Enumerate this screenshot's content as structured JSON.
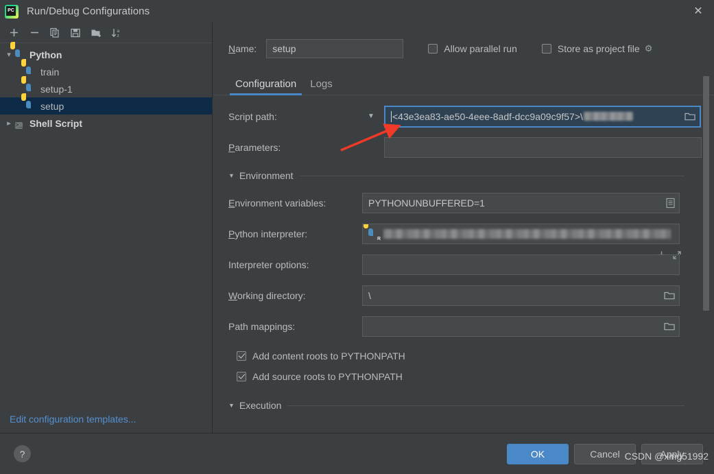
{
  "window": {
    "title": "Run/Debug Configurations",
    "logo_icon": "pycharm-logo",
    "close_icon": "close-icon"
  },
  "toolbar": {
    "buttons": [
      {
        "name": "add",
        "icon": "plus-icon",
        "label": "+"
      },
      {
        "name": "remove",
        "icon": "minus-icon",
        "label": "−"
      },
      {
        "name": "copy",
        "icon": "copy-icon",
        "label": "copy"
      },
      {
        "name": "save",
        "icon": "save-icon",
        "label": "save"
      },
      {
        "name": "new-folder",
        "icon": "folder-add-icon",
        "label": "new folder"
      },
      {
        "name": "sort-alphabetically",
        "icon": "sort-az-icon",
        "label": "sort a-z"
      }
    ]
  },
  "sidebar": {
    "tree": [
      {
        "label": "Python",
        "icon": "python-icon",
        "expanded": true,
        "level": 0,
        "selected": false,
        "chevron": "∨"
      },
      {
        "label": "train",
        "icon": "python-icon",
        "level": 1,
        "selected": false,
        "chevron": ""
      },
      {
        "label": "setup-1",
        "icon": "python-icon",
        "level": 1,
        "selected": false,
        "chevron": ""
      },
      {
        "label": "setup",
        "icon": "python-icon",
        "level": 1,
        "selected": true,
        "chevron": ""
      },
      {
        "label": "Shell Script",
        "icon": "shell-script-icon",
        "expanded": false,
        "level": 0,
        "selected": false,
        "chevron": "›"
      }
    ],
    "edit_templates_link": "Edit configuration templates..."
  },
  "header": {
    "name_label": "Name:",
    "name_value": "setup",
    "allow_parallel_run": {
      "label": "Allow parallel run",
      "checked": false
    },
    "store_as_project_file": {
      "label": "Store as project file",
      "checked": false,
      "gear_icon": "gear-icon"
    }
  },
  "tabs": [
    {
      "label": "Configuration",
      "active": true
    },
    {
      "label": "Logs",
      "active": false
    }
  ],
  "form": {
    "script_path": {
      "label": "Script path:",
      "value": "<43e3ea83-ae50-4eee-8adf-dcc9a09c9f57>\\",
      "redacted": true,
      "focused": true,
      "browse_icon": "folder-icon",
      "dropdown_icon": "chevron-down-icon"
    },
    "parameters": {
      "label": "Parameters:",
      "value": "",
      "add_icon": "plus-icon",
      "expand_icon": "expand-icon"
    },
    "environment_section": {
      "title": "Environment",
      "arrow_icon": "triangle-down-icon"
    },
    "environment_variables": {
      "label": "Environment variables:",
      "value": "PYTHONUNBUFFERED=1",
      "browse_icon": "list-icon"
    },
    "python_interpreter": {
      "label": "Python interpreter:",
      "value": "",
      "redacted": true,
      "icon": "python-interpreter-icon"
    },
    "interpreter_options": {
      "label": "Interpreter options:",
      "value": "",
      "expand_icon": "expand-icon"
    },
    "working_directory": {
      "label": "Working directory:",
      "value": "\\",
      "browse_icon": "folder-icon"
    },
    "path_mappings": {
      "label": "Path mappings:",
      "value": "",
      "browse_icon": "folder-icon"
    },
    "add_content_roots": {
      "label": "Add content roots to PYTHONPATH",
      "checked": true
    },
    "add_source_roots": {
      "label": "Add source roots to PYTHONPATH",
      "checked": true
    },
    "execution_section": {
      "title": "Execution",
      "arrow_icon": "triangle-down-icon"
    }
  },
  "footer": {
    "help_label": "?",
    "ok_label": "OK",
    "cancel_label": "Cancel",
    "apply_label": "Apply"
  },
  "watermark": "CSDN @xing51992",
  "colors": {
    "accent": "#4a88c7",
    "background": "#3c3f41",
    "field_background": "#45494a",
    "selected_row": "#0d2a47",
    "link": "#5590d0",
    "annotation_arrow": "#f03a28"
  }
}
